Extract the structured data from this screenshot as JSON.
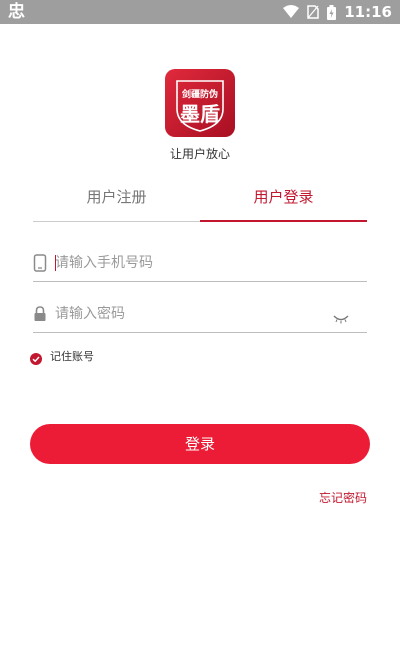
{
  "status_bar": {
    "left_glyph": "忠",
    "time": "11:16",
    "icons": [
      "wifi-icon",
      "sim-icon",
      "battery-icon"
    ]
  },
  "app": {
    "logo_text_top": "剑疆防伪",
    "logo_text_main": "墨盾",
    "slogan": "让用户放心"
  },
  "tabs": [
    {
      "label": "用户注册",
      "active": false
    },
    {
      "label": "用户登录",
      "active": true
    }
  ],
  "form": {
    "phone_placeholder": "请输入手机号码",
    "password_placeholder": "请输入密码",
    "remember_label": "记住账号",
    "remember_checked": true,
    "login_label": "登录",
    "forgot_label": "忘记密码"
  },
  "colors": {
    "accent": "#c3172f",
    "button": "#ec1c36",
    "status_bar": "#9e9e9e"
  }
}
